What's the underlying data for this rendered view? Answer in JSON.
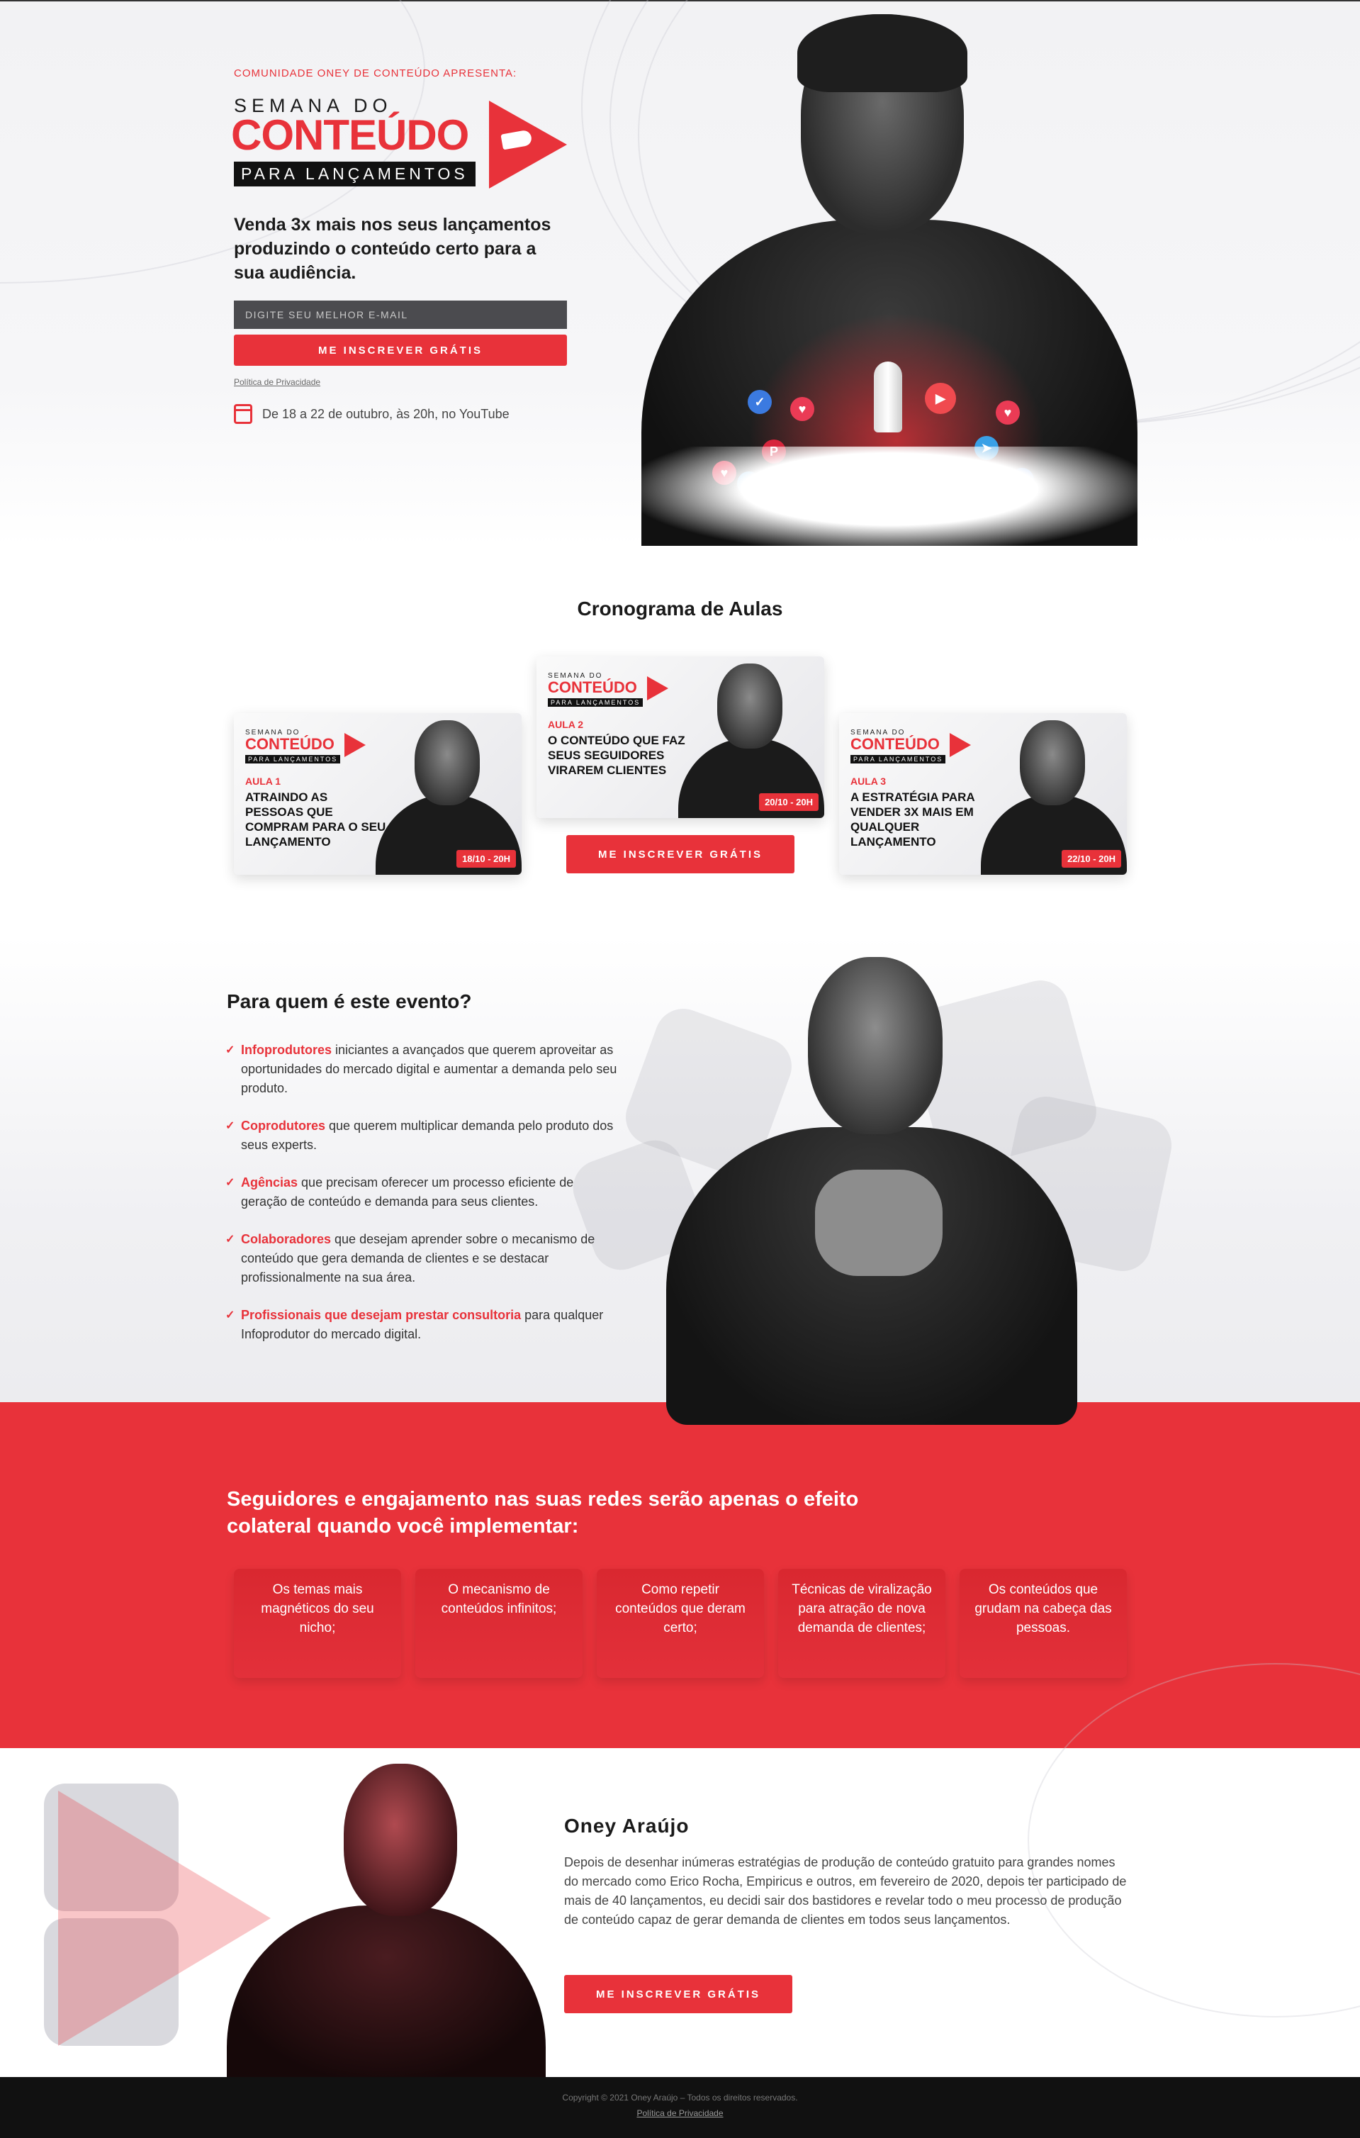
{
  "colors": {
    "accent": "#e8323a",
    "dark": "#111111"
  },
  "hero": {
    "eyebrow": "COMUNIDADE ONEY DE CONTEÚDO APRESENTA:",
    "logo": {
      "line1": "SEMANA DO",
      "line2": "CONTEÚDO",
      "line3": "PARA LANÇAMENTOS"
    },
    "headline": "Venda 3x mais nos seus lançamentos produzindo o conteúdo certo para a sua audiência.",
    "email_placeholder": "DIGITE SEU MELHOR E-MAIL",
    "button": "ME INSCREVER GRÁTIS",
    "policy": "Política de Privacidade",
    "date_icon": "calendar-icon",
    "date_text": "De 18 a 22 de outubro, às 20h, no YouTube"
  },
  "schedule": {
    "title": "Cronograma de Aulas",
    "button": "ME INSCREVER GRÁTIS",
    "cards": [
      {
        "logo1": "SEMANA DO",
        "logo2": "CONTEÚDO",
        "logo3": "PARA LANÇAMENTOS",
        "label": "AULA 1",
        "title": "ATRAINDO AS PESSOAS QUE COMPRAM PARA O SEU LANÇAMENTO",
        "badge": "18/10 - 20H"
      },
      {
        "logo1": "SEMANA DO",
        "logo2": "CONTEÚDO",
        "logo3": "PARA LANÇAMENTOS",
        "label": "AULA 2",
        "title": "O CONTEÚDO QUE FAZ SEUS SEGUIDORES VIRAREM CLIENTES",
        "badge": "20/10 - 20H"
      },
      {
        "logo1": "SEMANA DO",
        "logo2": "CONTEÚDO",
        "logo3": "PARA LANÇAMENTOS",
        "label": "AULA 3",
        "title": "A ESTRATÉGIA PARA VENDER 3X MAIS EM QUALQUER LANÇAMENTO",
        "badge": "22/10 - 20H"
      }
    ]
  },
  "audience": {
    "title": "Para quem é este evento?",
    "items": [
      {
        "highlight": "Infoprodutores",
        "text": " iniciantes a avançados que querem aproveitar as oportunidades do mercado digital e aumentar a demanda pelo seu produto."
      },
      {
        "highlight": "Coprodutores",
        "text": " que querem multiplicar demanda pelo produto dos seus experts."
      },
      {
        "highlight": "Agências",
        "text": " que precisam oferecer um processo eficiente de geração de conteúdo e demanda para seus clientes."
      },
      {
        "highlight": "Colaboradores",
        "text": " que desejam aprender sobre o mecanismo de conteúdo que gera demanda de clientes e se destacar profissionalmente na sua área."
      },
      {
        "highlight": "Profissionais que desejam prestar consultoria",
        "text": " para qualquer Infoprodutor do mercado digital."
      }
    ]
  },
  "benefits": {
    "title": "Seguidores e engajamento nas suas redes serão apenas o efeito colateral quando você implementar:",
    "items": [
      "Os temas mais magnéticos do seu nicho;",
      "O mecanismo de conteúdos infinitos;",
      "Como repetir conteúdos que deram certo;",
      "Técnicas de viralização para atração de nova demanda de clientes;",
      "Os conteúdos que grudam na cabeça das pessoas."
    ]
  },
  "bio": {
    "name": "Oney Araújo",
    "text": "Depois de desenhar inúmeras estratégias de produção de conteúdo gratuito para grandes nomes do mercado como Erico Rocha, Empiricus e outros, em fevereiro de 2020, depois ter participado de mais de 40 lançamentos, eu decidi sair dos bastidores e revelar todo o meu processo de produção de conteúdo capaz de gerar demanda de clientes em todos seus lançamentos.",
    "button": "ME INSCREVER GRÁTIS"
  },
  "footer": {
    "copyright": "Copyright © 2021 Oney Araújo – Todos os direitos reservados.",
    "policy": "Política de Privacidade"
  }
}
